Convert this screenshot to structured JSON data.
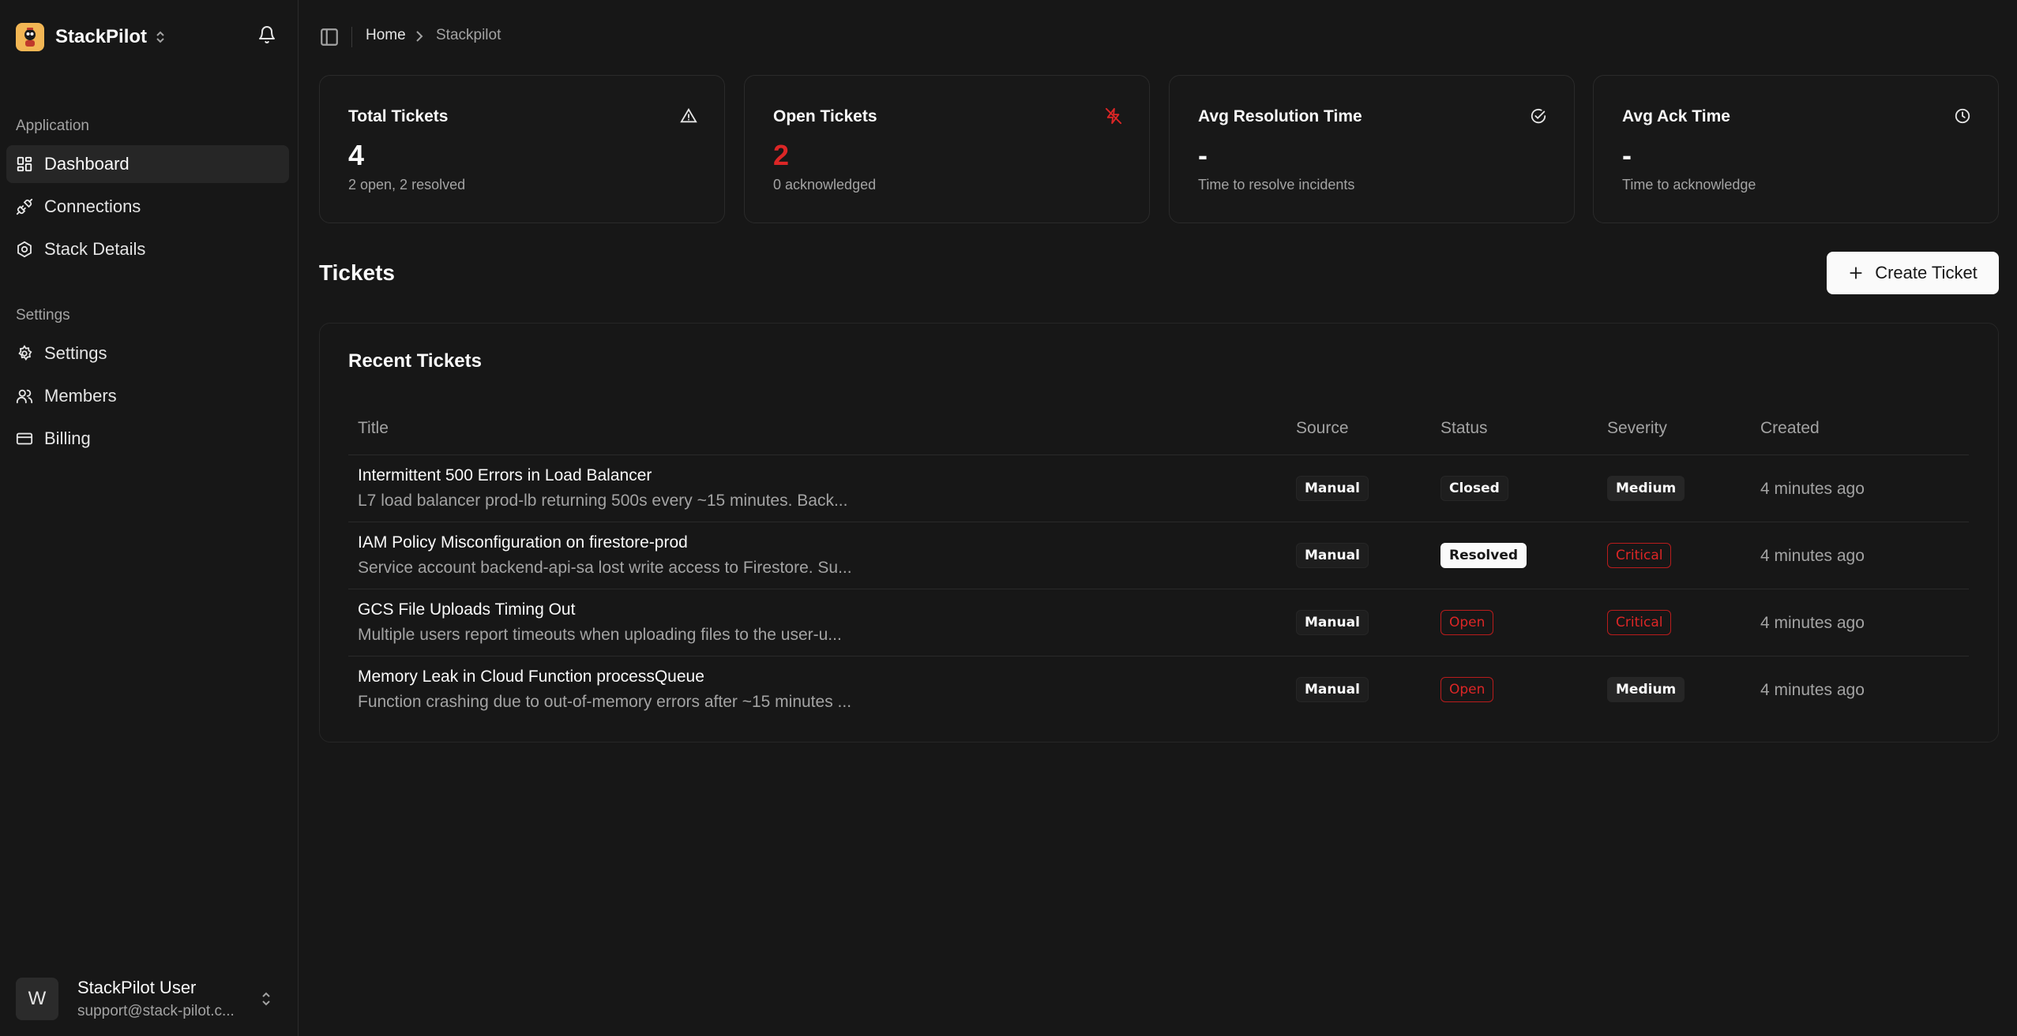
{
  "sidebar": {
    "brand": "StackPilot",
    "groups": [
      {
        "label": "Application",
        "items": [
          {
            "label": "Dashboard",
            "icon": "dashboard-icon",
            "active": true
          },
          {
            "label": "Connections",
            "icon": "plug-icon",
            "active": false
          },
          {
            "label": "Stack Details",
            "icon": "hexagon-icon",
            "active": false
          }
        ]
      },
      {
        "label": "Settings",
        "items": [
          {
            "label": "Settings",
            "icon": "gear-icon",
            "active": false
          },
          {
            "label": "Members",
            "icon": "users-icon",
            "active": false
          },
          {
            "label": "Billing",
            "icon": "credit-card-icon",
            "active": false
          }
        ]
      }
    ],
    "user": {
      "initial": "W",
      "name": "StackPilot User",
      "email": "support@stack-pilot.c..."
    }
  },
  "breadcrumb": {
    "home": "Home",
    "current": "Stackpilot"
  },
  "stats": [
    {
      "title": "Total Tickets",
      "value": "4",
      "sub": "2 open, 2 resolved",
      "icon": "warning-triangle-icon",
      "accent": false
    },
    {
      "title": "Open Tickets",
      "value": "2",
      "sub": "0 acknowledged",
      "icon": "zap-off-icon",
      "accent": true
    },
    {
      "title": "Avg Resolution Time",
      "value": "-",
      "sub": "Time to resolve incidents",
      "icon": "check-circle-icon",
      "accent": false
    },
    {
      "title": "Avg Ack Time",
      "value": "-",
      "sub": "Time to acknowledge",
      "icon": "clock-icon",
      "accent": false
    }
  ],
  "tickets_section": {
    "title": "Tickets",
    "create_label": "Create Ticket"
  },
  "recent": {
    "title": "Recent Tickets",
    "columns": [
      "Title",
      "Source",
      "Status",
      "Severity",
      "Created"
    ],
    "rows": [
      {
        "title": "Intermittent 500 Errors in Load Balancer",
        "desc": "L7 load balancer prod-lb returning 500s every ~15 minutes. Back...",
        "source": "Manual",
        "status": "Closed",
        "severity": "Medium",
        "created": "4 minutes ago"
      },
      {
        "title": "IAM Policy Misconfiguration on firestore-prod",
        "desc": "Service account backend-api-sa lost write access to Firestore. Su...",
        "source": "Manual",
        "status": "Resolved",
        "severity": "Critical",
        "created": "4 minutes ago"
      },
      {
        "title": "GCS File Uploads Timing Out",
        "desc": "Multiple users report timeouts when uploading files to the user-u...",
        "source": "Manual",
        "status": "Open",
        "severity": "Critical",
        "created": "4 minutes ago"
      },
      {
        "title": "Memory Leak in Cloud Function processQueue",
        "desc": "Function crashing due to out-of-memory errors after ~15 minutes ...",
        "source": "Manual",
        "status": "Open",
        "severity": "Medium",
        "created": "4 minutes ago"
      }
    ]
  },
  "colors": {
    "background": "#171717",
    "accent_red": "#dc2626",
    "muted": "#a3a3a3"
  }
}
